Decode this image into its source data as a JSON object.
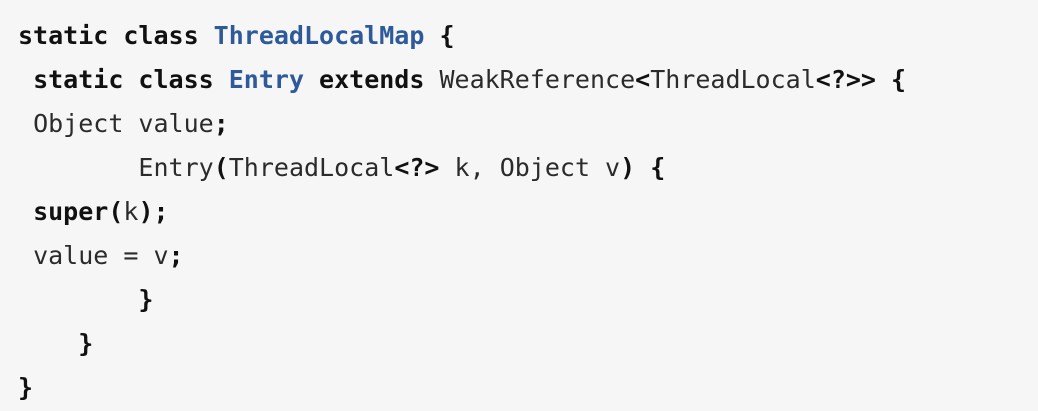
{
  "code": {
    "lines": [
      {
        "indent": "",
        "tokens": [
          {
            "text": "static class ",
            "kind": "kw"
          },
          {
            "text": "ThreadLocalMap",
            "kind": "type"
          },
          {
            "text": " {",
            "kind": "punc"
          }
        ]
      },
      {
        "indent": " ",
        "tokens": [
          {
            "text": "static class ",
            "kind": "kw"
          },
          {
            "text": "Entry",
            "kind": "type"
          },
          {
            "text": " extends ",
            "kind": "kw"
          },
          {
            "text": "WeakReference",
            "kind": "plain"
          },
          {
            "text": "<",
            "kind": "punc"
          },
          {
            "text": "ThreadLocal",
            "kind": "plain"
          },
          {
            "text": "<?>> {",
            "kind": "punc"
          }
        ]
      },
      {
        "indent": " ",
        "tokens": [
          {
            "text": "Object value",
            "kind": "plain"
          },
          {
            "text": ";",
            "kind": "punc"
          }
        ]
      },
      {
        "indent": "        ",
        "tokens": [
          {
            "text": "Entry",
            "kind": "plain"
          },
          {
            "text": "(",
            "kind": "punc"
          },
          {
            "text": "ThreadLocal",
            "kind": "plain"
          },
          {
            "text": "<?>",
            "kind": "punc"
          },
          {
            "text": " k, Object v",
            "kind": "plain"
          },
          {
            "text": ") {",
            "kind": "punc"
          }
        ]
      },
      {
        "indent": " ",
        "tokens": [
          {
            "text": "super",
            "kind": "kw"
          },
          {
            "text": "(",
            "kind": "punc"
          },
          {
            "text": "k",
            "kind": "plain"
          },
          {
            "text": ");",
            "kind": "punc"
          }
        ]
      },
      {
        "indent": " ",
        "tokens": [
          {
            "text": "value = v",
            "kind": "plain"
          },
          {
            "text": ";",
            "kind": "punc"
          }
        ]
      },
      {
        "indent": "        ",
        "tokens": [
          {
            "text": "}",
            "kind": "punc"
          }
        ]
      },
      {
        "indent": "    ",
        "tokens": [
          {
            "text": "}",
            "kind": "punc"
          }
        ]
      },
      {
        "indent": "",
        "tokens": [
          {
            "text": "}",
            "kind": "punc"
          }
        ]
      }
    ]
  },
  "colors": {
    "background": "#f6f6f6",
    "keyword": "#111111",
    "type_name": "#2f5a9a",
    "plain": "#2b2b2b"
  }
}
